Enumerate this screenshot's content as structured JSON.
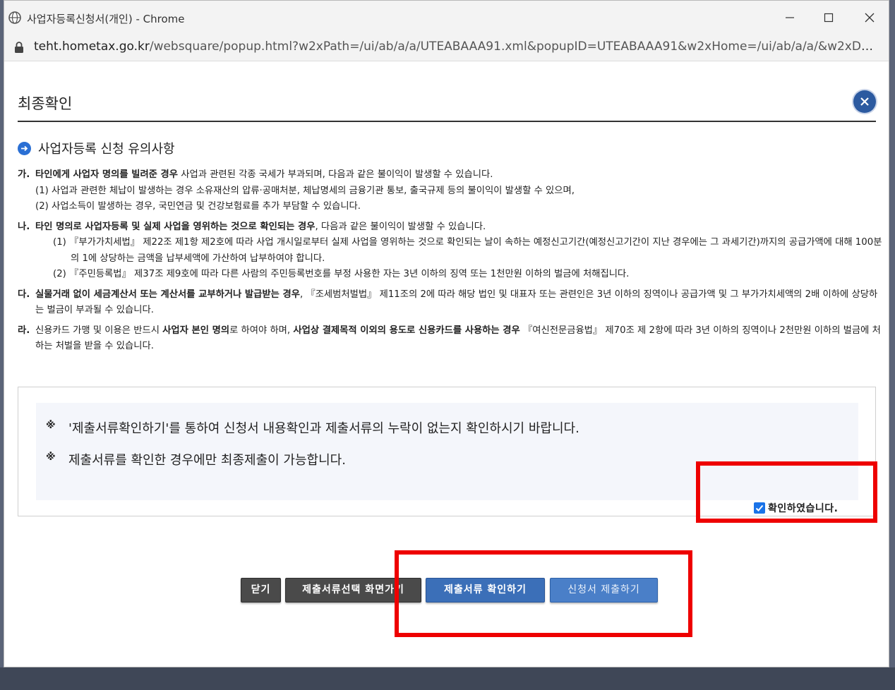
{
  "window": {
    "title": "사업자등록신청서(개인) - Chrome",
    "url_host": "teht.hometax.go.kr",
    "url_path": "/websquare/popup.html?w2xPath=/ui/ab/a/a/UTEABAAA91.xml&popupID=UTEABAAA91&w2xHome=/ui/ab/a/a/&w2xDocument..."
  },
  "page": {
    "title": "최종확인",
    "section_heading": "사업자등록 신청 유의사항"
  },
  "notes": {
    "ga": {
      "mark": "가.",
      "bold": "타인에게 사업자 명의를 빌려준 경우",
      "text": " 사업과 관련된 각종 국세가 부과되며, 다음과 같은 불이익이 발생할 수 있습니다.",
      "sub1": "(1) 사업과 관련한 체납이 발생하는 경우 소유재산의 압류·공매처분, 체납명세의 금융기관 통보, 출국규제 등의 불이익이 발생할 수 있으며,",
      "sub2": "(2) 사업소득이 발생하는 경우, 국민연금 및 건강보험료를 추가 부담할 수 있습니다."
    },
    "na": {
      "mark": "나.",
      "bold": "타인 명의로 사업자등록 및 실제 사업을 영위하는 것으로 확인되는 경우",
      "text": ", 다음과 같은 불이익이 발생할 수 있습니다.",
      "sub1": "(1) 『부가가치세법』 제22조 제1항 제2호에 따라 사업 개시일로부터 실제 사업을 영위하는 것으로 확인되는 날이 속하는 예정신고기간(예정신고기간이 지난 경우에는 그 과세기간)까지의 공급가액에 대해 100분의 1에 상당하는 금액을 납부세액에 가산하여 납부하여야 합니다.",
      "sub2": "(2) 『주민등록법』 제37조 제9호에 따라 다른 사람의 주민등록번호를 부정 사용한 자는 3년 이하의 징역 또는 1천만원 이하의 벌금에 처해집니다."
    },
    "da": {
      "mark": "다.",
      "bold": "실물거래 없이 세금계산서 또는 계산서를 교부하거나 발급받는 경우",
      "text": ", 『조세범처벌법』 제11조의 2에 따라 해당 법인 및 대표자 또는 관련인은 3년 이하의 징역이나 공급가액 및 그 부가가치세액의 2배 이하에 상당하는 벌금이 부과될 수 있습니다."
    },
    "ra": {
      "mark": "라.",
      "text1": "신용카드 가맹 및 이용은 반드시 ",
      "bold1": "사업자 본인 명의",
      "text2": "로 하여야 하며, ",
      "bold2": "사업상 결제목적 이외의 용도로 신용카드를 사용하는 경우",
      "text3": " 『여신전문금융법』 제70조 제 2항에 따라 3년 이하의 징역이나 2천만원 이하의 벌금에 처하는 처벌을 받을 수 있습니다."
    }
  },
  "confirm": {
    "mark": "※",
    "line1": "'제출서류확인하기'를 통하여 신청서 내용확인과 제출서류의 누락이 없는지 확인하시기 바랍니다.",
    "line2": "제출서류를 확인한 경우에만 최종제출이 가능합니다.",
    "checkbox_label": "확인하였습니다.",
    "checkbox_checked": true
  },
  "buttons": {
    "close": "닫기",
    "doc_select": "제출서류선택 화면가기",
    "doc_check": "제출서류 확인하기",
    "submit": "신청서 제출하기"
  },
  "colors": {
    "accent": "#3b6fb8",
    "highlight": "#ee0000"
  }
}
